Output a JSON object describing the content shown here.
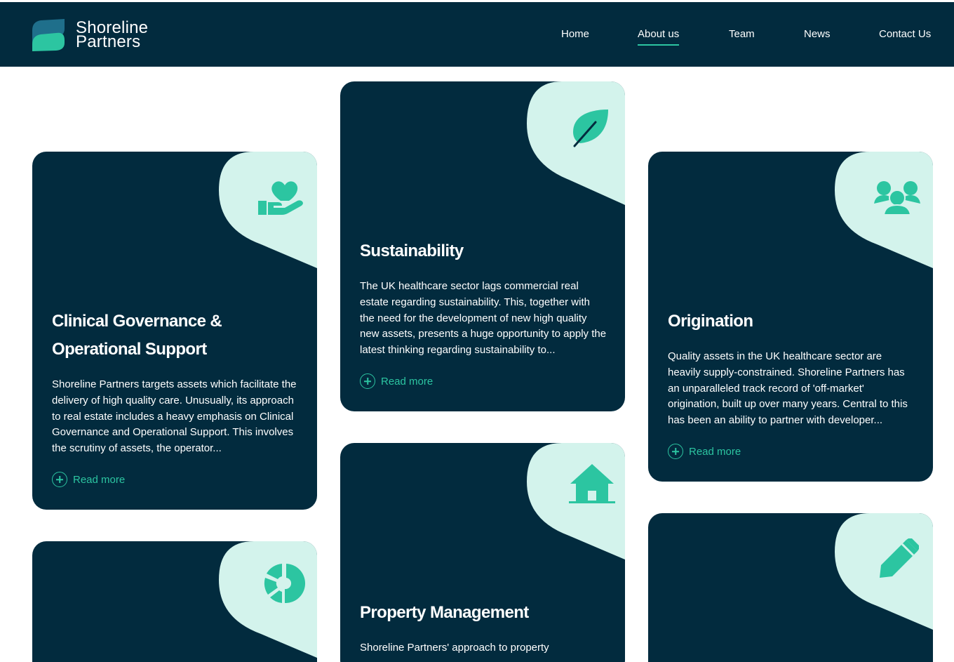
{
  "brand": {
    "line1": "Shoreline",
    "line2": "Partners",
    "logo_icon": "s-wave-logo-icon"
  },
  "nav": {
    "items": [
      {
        "label": "Home",
        "active": false
      },
      {
        "label": "About us",
        "active": true
      },
      {
        "label": "Team",
        "active": false
      },
      {
        "label": "News",
        "active": false
      },
      {
        "label": "Contact Us",
        "active": false
      }
    ]
  },
  "cards": [
    {
      "title": "Clinical Governance & Operational Support",
      "icon": "hand-heart-icon",
      "text": "Shoreline Partners targets assets which facilitate the delivery of high quality care. Unusually, its approach to real estate includes a heavy emphasis on Clinical Governance and Operational Support. This involves the scrutiny of assets, the operator...",
      "cta": "Read more"
    },
    {
      "title": "Sustainability",
      "icon": "leaf-icon",
      "text": "The UK healthcare sector lags commercial real estate regarding sustainability. This, together with the need for the development of new high quality new assets, presents a huge opportunity to apply the latest thinking regarding sustainability to...",
      "cta": "Read more"
    },
    {
      "title": "Origination",
      "icon": "users-group-icon",
      "text": "Quality assets in the UK healthcare sector are heavily supply-constrained. Shoreline Partners has an unparalleled track record of 'off-market' origination, built up over many years. Central to this has been an ability to partner with developer...",
      "cta": "Read more"
    },
    {
      "title": "Property Management",
      "icon": "house-icon",
      "text": "Shoreline Partners' approach to property"
    },
    {
      "icon": "pie-chart-icon"
    },
    {
      "icon": "pencil-icon"
    }
  ],
  "colors": {
    "navy": "#022b3e",
    "accent": "#2cc5a1",
    "blob": "#d3f3ec"
  }
}
